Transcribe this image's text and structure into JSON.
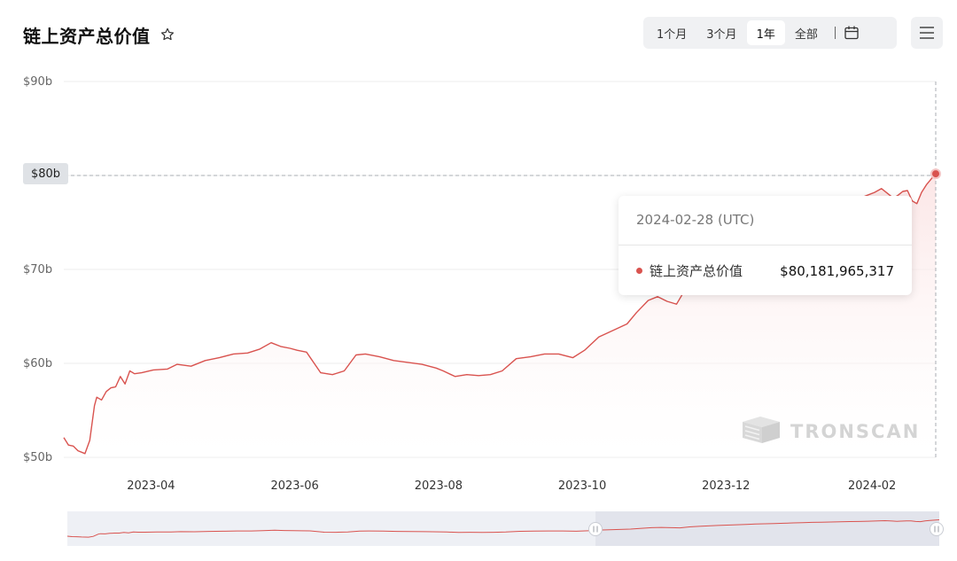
{
  "header": {
    "title": "链上资产总价值",
    "star_icon": "star-outline-icon"
  },
  "range_selector": {
    "options": [
      "1个月",
      "3个月",
      "1年",
      "全部"
    ],
    "selected": "1年",
    "calendar_icon": "calendar-icon"
  },
  "menu_icon": "hamburger-menu-icon",
  "crosshair_badge": "$80b",
  "tooltip": {
    "date": "2024-02-28 (UTC)",
    "series_name": "链上资产总价值",
    "value": "$80,181,965,317",
    "dot_color": "#d9534f"
  },
  "watermark": {
    "text": "TRONSCAN"
  },
  "colors": {
    "line": "#d9534f",
    "area_top": "#fdecec",
    "grid": "#f0f0f0",
    "navigator_bg": "#eef0f5",
    "navigator_selected": "#e2e4ec"
  },
  "chart_data": {
    "type": "area",
    "title": "链上资产总价值",
    "xlabel": "",
    "ylabel": "",
    "y_unit": "billion USD",
    "ylim": [
      50,
      90
    ],
    "y_ticks": [
      "$50b",
      "$60b",
      "$70b",
      "$80b",
      "$90b"
    ],
    "y_tick_values": [
      50,
      60,
      70,
      80,
      90
    ],
    "x_range": [
      "2023-02-23",
      "2024-02-28"
    ],
    "x_ticks": [
      "2023-04",
      "2023-06",
      "2023-08",
      "2023-10",
      "2023-12",
      "2024-02"
    ],
    "x_tick_dates": [
      "2023-04-01",
      "2023-06-01",
      "2023-08-01",
      "2023-10-01",
      "2023-12-01",
      "2024-02-01"
    ],
    "grid": "horizontal",
    "series": [
      {
        "name": "链上资产总价值",
        "x": [
          "2023-02-23",
          "2023-02-25",
          "2023-02-27",
          "2023-03-01",
          "2023-03-04",
          "2023-03-06",
          "2023-03-08",
          "2023-03-09",
          "2023-03-11",
          "2023-03-13",
          "2023-03-15",
          "2023-03-17",
          "2023-03-19",
          "2023-03-21",
          "2023-03-23",
          "2023-03-25",
          "2023-03-28",
          "2023-04-02",
          "2023-04-08",
          "2023-04-12",
          "2023-04-18",
          "2023-04-24",
          "2023-04-30",
          "2023-05-06",
          "2023-05-12",
          "2023-05-17",
          "2023-05-22",
          "2023-05-26",
          "2023-05-30",
          "2023-06-02",
          "2023-06-06",
          "2023-06-12",
          "2023-06-17",
          "2023-06-22",
          "2023-06-27",
          "2023-07-01",
          "2023-07-07",
          "2023-07-13",
          "2023-07-19",
          "2023-07-25",
          "2023-07-31",
          "2023-08-03",
          "2023-08-08",
          "2023-08-13",
          "2023-08-18",
          "2023-08-23",
          "2023-08-28",
          "2023-09-03",
          "2023-09-09",
          "2023-09-15",
          "2023-09-21",
          "2023-09-27",
          "2023-10-02",
          "2023-10-08",
          "2023-10-14",
          "2023-10-20",
          "2023-10-24",
          "2023-10-29",
          "2023-11-02",
          "2023-11-06",
          "2023-11-10",
          "2023-11-14",
          "2023-11-18",
          "2023-11-22",
          "2023-11-26",
          "2023-11-30",
          "2023-12-04",
          "2023-12-08",
          "2023-12-12",
          "2023-12-16",
          "2023-12-20",
          "2023-12-24",
          "2023-12-28",
          "2024-01-01",
          "2024-01-05",
          "2024-01-09",
          "2024-01-13",
          "2024-01-17",
          "2024-01-21",
          "2024-01-25",
          "2024-01-29",
          "2024-02-02",
          "2024-02-05",
          "2024-02-08",
          "2024-02-10",
          "2024-02-12",
          "2024-02-14",
          "2024-02-16",
          "2024-02-18",
          "2024-02-20",
          "2024-02-22",
          "2024-02-24",
          "2024-02-26",
          "2024-02-28"
        ],
        "y": [
          52.1,
          51.3,
          51.2,
          50.7,
          50.4,
          51.8,
          55.5,
          56.4,
          56.1,
          57.0,
          57.4,
          57.5,
          58.6,
          57.8,
          59.2,
          58.9,
          59.0,
          59.3,
          59.4,
          59.9,
          59.7,
          60.3,
          60.6,
          61.0,
          61.1,
          61.5,
          62.2,
          61.8,
          61.6,
          61.4,
          61.2,
          59.0,
          58.8,
          59.2,
          60.9,
          61.0,
          60.7,
          60.3,
          60.1,
          59.9,
          59.5,
          59.2,
          58.6,
          58.8,
          58.7,
          58.8,
          59.2,
          60.5,
          60.7,
          61.0,
          61.0,
          60.6,
          61.4,
          62.8,
          63.5,
          64.2,
          65.4,
          66.7,
          67.1,
          66.6,
          66.3,
          68.0,
          69.0,
          69.7,
          70.4,
          71.1,
          71.6,
          72.3,
          72.9,
          73.4,
          73.8,
          74.2,
          74.8,
          75.3,
          75.7,
          76.0,
          76.4,
          76.8,
          77.1,
          77.3,
          77.8,
          78.2,
          78.6,
          78.0,
          77.6,
          77.9,
          78.3,
          78.4,
          77.3,
          77.0,
          78.2,
          79.0,
          79.6,
          80.18
        ]
      }
    ]
  }
}
